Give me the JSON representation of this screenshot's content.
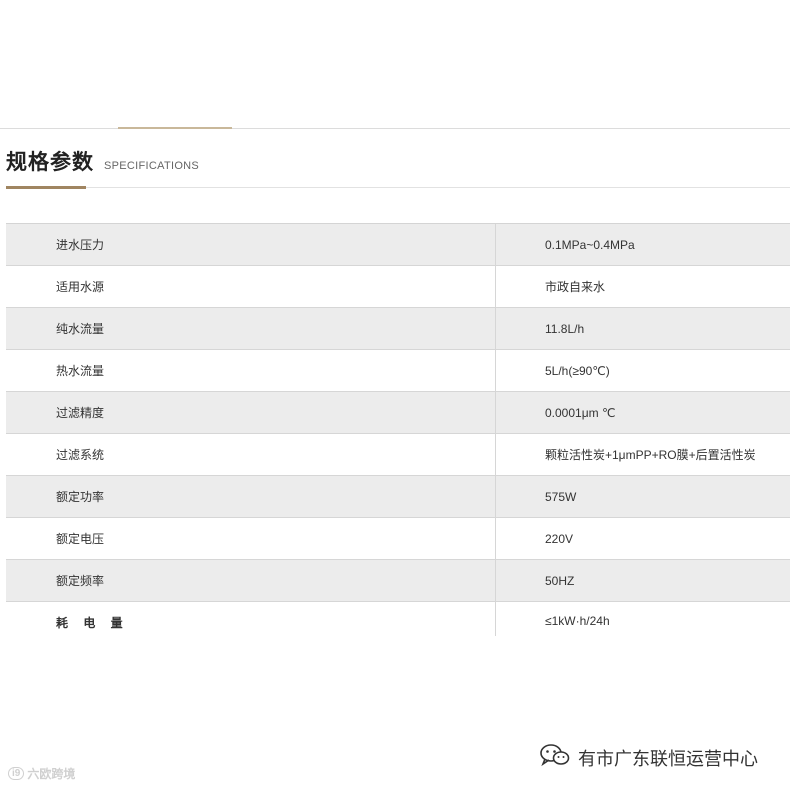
{
  "section": {
    "title": "规格参数",
    "subtitle": "SPECIFICATIONS"
  },
  "specs": [
    {
      "label": "进水压力",
      "value": "0.1MPa~0.4MPa"
    },
    {
      "label": "适用水源",
      "value": "市政自来水"
    },
    {
      "label": "纯水流量",
      "value": "11.8L/h"
    },
    {
      "label": "热水流量",
      "value": "5L/h(≥90℃)"
    },
    {
      "label": "过滤精度",
      "value": "0.0001μm ℃"
    },
    {
      "label": "过滤系统",
      "value": "颗粒活性炭+1μmPP+RO膜+后置活性炭"
    },
    {
      "label": "额定功率",
      "value": "575W"
    },
    {
      "label": "额定电压",
      "value": "220V"
    },
    {
      "label": "额定频率",
      "value": "50HZ"
    },
    {
      "label": "耗 电 量",
      "value": "≤1kW·h/24h"
    }
  ],
  "watermarks": {
    "left_badge": "i9",
    "left_text": "六欧跨境",
    "right_text": "有市广东联恒运营中心"
  },
  "icons": {
    "wechat": "wechat-icon"
  },
  "colors": {
    "accent": "#a08561",
    "row_shade": "#ececec"
  }
}
